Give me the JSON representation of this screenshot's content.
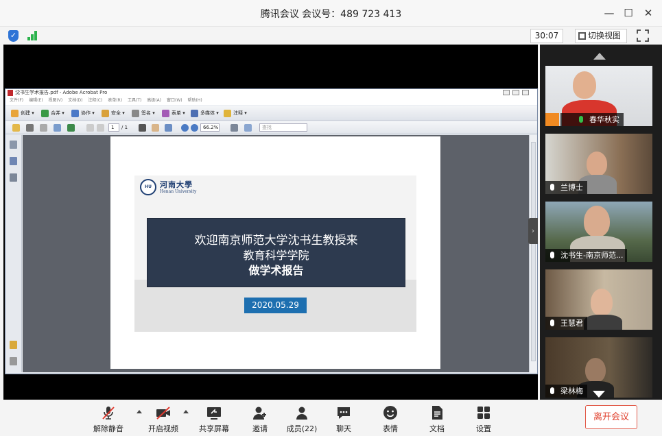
{
  "window": {
    "title": "腾讯会议 会议号：489 723 413",
    "minimize_glyph": "—",
    "maximize_glyph": "☐",
    "close_glyph": "✕"
  },
  "status": {
    "timer": "30:07",
    "switch_view_label": "切换视图",
    "security_icon": "shield-icon",
    "network_icon": "signal-icon"
  },
  "acrobat": {
    "window_title": "沈书生学术报告.pdf - Adobe Acrobat Pro",
    "menu": [
      "文件(F)",
      "编辑(E)",
      "视图(V)",
      "文档(D)",
      "注释(C)",
      "表单(R)",
      "工具(T)",
      "高级(A)",
      "窗口(W)",
      "帮助(H)"
    ],
    "toolbar1": [
      "创建",
      "合并",
      "协作",
      "安全",
      "签名",
      "表单",
      "多媒体",
      "注释"
    ],
    "page_current": "1",
    "page_total": "/ 1",
    "zoom": "66.2%",
    "find_placeholder": "查找"
  },
  "slide": {
    "logo_cn": "河南大學",
    "logo_en": "Henan University",
    "line1": "欢迎南京师范大学沈书生教授来",
    "line2": "教育科学学院",
    "line3": "做学术报告",
    "date": "2020.05.29"
  },
  "participants": [
    {
      "name": "春华秋实",
      "mic_active": true
    },
    {
      "name": "兰博士",
      "mic_active": false
    },
    {
      "name": "沈书生-南京师范...",
      "mic_active": false
    },
    {
      "name": "王慧君",
      "mic_active": false
    },
    {
      "name": "梁林梅",
      "mic_active": false
    }
  ],
  "toolbar": {
    "mute": "解除静音",
    "video": "开启视频",
    "share": "共享屏幕",
    "invite": "邀请",
    "members": "成员(22)",
    "chat": "聊天",
    "reactions": "表情",
    "docs": "文档",
    "settings": "设置",
    "leave": "离开会议"
  },
  "colors": {
    "leave_red": "#e0402d",
    "mic_green": "#33c04a",
    "banner_navy": "#2d3a4f",
    "date_blue": "#1d6fb0",
    "signal_green": "#2bb24c",
    "shield_blue": "#2e74d6"
  }
}
